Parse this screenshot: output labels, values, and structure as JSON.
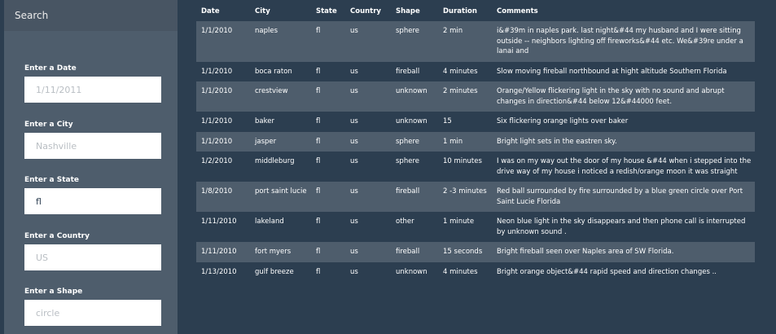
{
  "sidebar": {
    "header": "Search",
    "filters": [
      {
        "label": "Enter a Date",
        "value": "",
        "placeholder": "1/11/2011"
      },
      {
        "label": "Enter a City",
        "value": "",
        "placeholder": "Nashville"
      },
      {
        "label": "Enter a State",
        "value": "fl",
        "placeholder": ""
      },
      {
        "label": "Enter a Country",
        "value": "",
        "placeholder": "US"
      },
      {
        "label": "Enter a Shape",
        "value": "",
        "placeholder": "circle"
      }
    ]
  },
  "table": {
    "columns": [
      "Date",
      "City",
      "State",
      "Country",
      "Shape",
      "Duration",
      "Comments"
    ],
    "rows": [
      [
        "1/1/2010",
        "naples",
        "fl",
        "us",
        "sphere",
        "2 min",
        "i&#39m in naples park. last night&#44 my husband and I were sitting outside -- neighbors lighting off fireworks&#44 etc. We&#39re under a lanai and"
      ],
      [
        "1/1/2010",
        "boca raton",
        "fl",
        "us",
        "fireball",
        "4 minutes",
        "Slow moving fireball northbound at hight altitude Southern Florida"
      ],
      [
        "1/1/2010",
        "crestview",
        "fl",
        "us",
        "unknown",
        "2 minutes",
        "Orange/Yellow flickering light in the sky with no sound and abrupt changes in direction&#44 below 12&#44000 feet."
      ],
      [
        "1/1/2010",
        "baker",
        "fl",
        "us",
        "unknown",
        "15",
        "Six flickering orange lights over baker"
      ],
      [
        "1/1/2010",
        "jasper",
        "fl",
        "us",
        "sphere",
        "1 min",
        "Bright light sets in the eastren sky."
      ],
      [
        "1/2/2010",
        "middleburg",
        "fl",
        "us",
        "sphere",
        "10 minutes",
        "I was on my way out the door of my house &#44 when i stepped into the drive way of my house i noticed a redish/orange moon it was straight"
      ],
      [
        "1/8/2010",
        "port saint lucie",
        "fl",
        "us",
        "fireball",
        "2 -3 minutes",
        "Red ball surrounded by fire surrounded by a blue green circle over Port Saint Lucie Florida"
      ],
      [
        "1/11/2010",
        "lakeland",
        "fl",
        "us",
        "other",
        "1 minute",
        "Neon blue light in the sky disappears and then phone call is interrupted by unknown sound ."
      ],
      [
        "1/11/2010",
        "fort myers",
        "fl",
        "us",
        "fireball",
        "15 seconds",
        "Bright fireball seen over Naples area of SW Florida."
      ],
      [
        "1/13/2010",
        "gulf breeze",
        "fl",
        "us",
        "unknown",
        "4 minutes",
        "Bright orange object&#44 rapid speed and direction changes .."
      ]
    ]
  }
}
